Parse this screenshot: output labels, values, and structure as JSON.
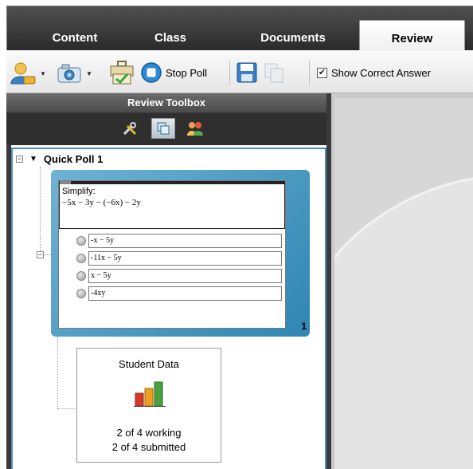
{
  "tabs": [
    {
      "label": "Content"
    },
    {
      "label": "Class"
    },
    {
      "label": "Documents"
    },
    {
      "label": "Review"
    }
  ],
  "toolbar": {
    "stop_poll_label": "Stop Poll",
    "show_correct_answer_label": "Show Correct Answer",
    "show_correct_answer_checked": true
  },
  "panel": {
    "title": "Review Toolbox",
    "tools": [
      "tools-icon",
      "slides-icon",
      "students-icon"
    ],
    "active_tool": "slides-icon"
  },
  "tree": {
    "root_label": "Quick Poll 1",
    "slide": {
      "question": "Simplify:",
      "expression": "−5x − 3y − (−6x) − 2y",
      "options": [
        "-x − 5y",
        "-11x − 5y",
        "x − 5y",
        "-4xy"
      ],
      "number": "1"
    },
    "student_data": {
      "title": "Student Data",
      "working": "2 of 4 working",
      "submitted": "2 of 4 submitted"
    }
  },
  "colors": {
    "accent": "#3a8cb8",
    "chart_red": "#d43a2a",
    "chart_orange": "#f0a020",
    "chart_green": "#4aa040"
  }
}
